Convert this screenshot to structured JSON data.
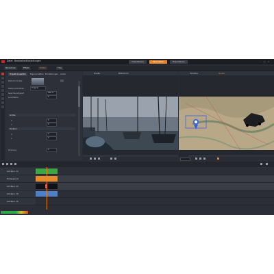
{
  "menu": {
    "items": [
      "Datei",
      "Bearbeiten",
      "Einstellungen"
    ]
  },
  "modes": [
    {
      "label": "Importieren",
      "active": false
    },
    {
      "label": "Bearbeiten",
      "active": true
    },
    {
      "label": "Exportieren",
      "active": false
    }
  ],
  "panel_tabs": [
    {
      "label": "Bibliothek",
      "active": false
    },
    {
      "label": "Effekt",
      "active": false
    },
    {
      "label": "Editor",
      "active": true
    },
    {
      "label": "Titel",
      "active": false
    }
  ],
  "inspector": {
    "subtabs": [
      {
        "label": "Projekt-Inspektor",
        "active": true
      },
      {
        "label": "Eigenschaften",
        "active": false
      },
      {
        "label": "Einstellungen",
        "active": false
      },
      {
        "label": "Audio",
        "active": false
      }
    ],
    "rows": [
      {
        "label": "Bildschirmrate",
        "value": ""
      },
      {
        "label": "Seitenverhältnis",
        "value": "Original"
      },
      {
        "label": "Geschwindigkeit",
        "value": "100 %"
      },
      {
        "label": "Lautstärke",
        "value": "0"
      }
    ],
    "sections": [
      {
        "title": "Größe",
        "fields": [
          {
            "label": "X",
            "value": "0"
          },
          {
            "label": "Y",
            "value": "0"
          }
        ]
      },
      {
        "title": "Position",
        "fields": [
          {
            "label": "X",
            "value": "0"
          },
          {
            "label": "Y",
            "value": "0"
          }
        ]
      }
    ],
    "last": {
      "label": "Drehung",
      "value": "0"
    }
  },
  "viewer_left": {
    "tabs": [
      {
        "label": "Quelle",
        "active": false
      },
      {
        "label": "Bildschirm",
        "active": false
      }
    ]
  },
  "viewer_right": {
    "tabs": [
      {
        "label": "Timeline",
        "active": false
      },
      {
        "label": "Quelle",
        "active": true
      }
    ]
  },
  "timeline": {
    "tracks": [
      {
        "name": "A/V-Spur (1)"
      },
      {
        "name": "Hintergrund"
      },
      {
        "name": "A/V-Spur (2)"
      },
      {
        "name": "A/V-Spur (3)"
      },
      {
        "name": "A/V-Spur (4)"
      }
    ]
  },
  "colors": {
    "accent": "#e8862a",
    "app_bg": "#2a2d35",
    "close_button": "#c62e2e"
  }
}
